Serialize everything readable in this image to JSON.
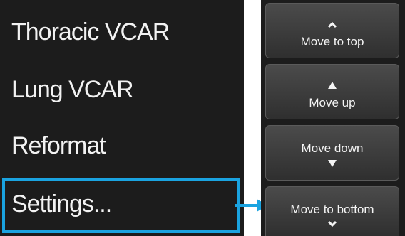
{
  "menu": {
    "items": [
      {
        "label": "Thoracic VCAR"
      },
      {
        "label": "Lung VCAR"
      },
      {
        "label": "Reformat"
      },
      {
        "label": "Settings..."
      }
    ],
    "highlighted_item": "Settings..."
  },
  "buttons": [
    {
      "label": "Move to top",
      "icon": "chevron-up-icon"
    },
    {
      "label": "Move up",
      "icon": "triangle-up-icon"
    },
    {
      "label": "Move down",
      "icon": "triangle-down-icon"
    },
    {
      "label": "Move to bottom",
      "icon": "chevron-down-icon"
    }
  ],
  "colors": {
    "panel_background": "#1c1c1c",
    "highlight": "#1aa3e0",
    "text": "#f2f2f2"
  }
}
